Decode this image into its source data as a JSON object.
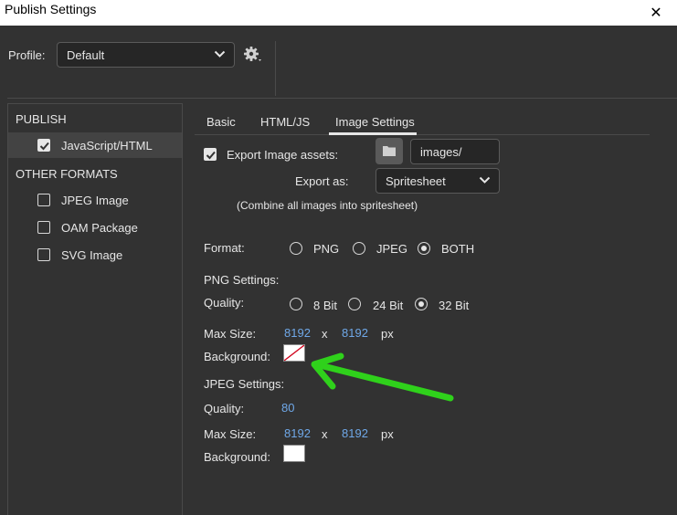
{
  "window": {
    "title": "Publish Settings",
    "close_glyph": "✕"
  },
  "profile": {
    "label": "Profile:",
    "value": "Default"
  },
  "sidebar": {
    "publish_header": "PUBLISH",
    "publish_items": [
      {
        "label": "JavaScript/HTML",
        "checked": true
      }
    ],
    "other_header": "OTHER FORMATS",
    "other_items": [
      {
        "label": "JPEG Image",
        "checked": false
      },
      {
        "label": "OAM Package",
        "checked": false
      },
      {
        "label": "SVG Image",
        "checked": false
      }
    ]
  },
  "tabs": {
    "basic": "Basic",
    "html": "HTML/JS",
    "image": "Image Settings",
    "active": "Image Settings"
  },
  "export": {
    "assets_label": "Export Image assets:",
    "assets_checked": true,
    "folder_value": "images/",
    "export_as_label": "Export as:",
    "export_as_value": "Spritesheet",
    "hint": "(Combine all images into spritesheet)"
  },
  "format": {
    "label": "Format:",
    "options": [
      "PNG",
      "JPEG",
      "BOTH"
    ],
    "selected": "BOTH"
  },
  "png": {
    "header": "PNG Settings:",
    "quality_label": "Quality:",
    "quality_options": [
      "8 Bit",
      "24 Bit",
      "32 Bit"
    ],
    "quality_selected": "32 Bit",
    "maxsize_label": "Max Size:",
    "width": "8192",
    "x": "x",
    "height": "8192",
    "unit": "px",
    "background_label": "Background:",
    "background": "transparent"
  },
  "jpeg": {
    "header": "JPEG Settings:",
    "quality_label": "Quality:",
    "quality": "80",
    "maxsize_label": "Max Size:",
    "width": "8192",
    "x": "x",
    "height": "8192",
    "unit": "px",
    "background_label": "Background:",
    "background": "#ffffff"
  },
  "colors": {
    "link_blue": "#6fa8e8",
    "annotation_green": "#2fd11b",
    "panel_bg": "#323232"
  }
}
